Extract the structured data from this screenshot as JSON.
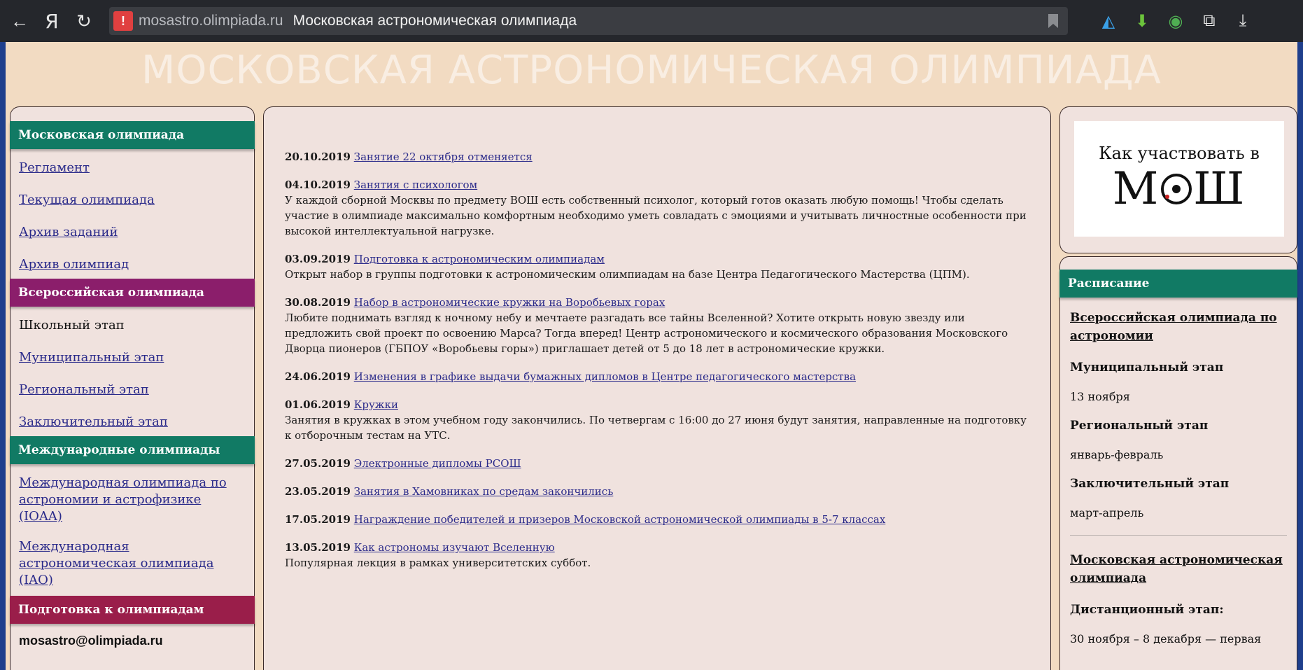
{
  "browser": {
    "back_icon": "←",
    "yandex_icon": "Я",
    "reload_icon": "↻",
    "warning_icon": "!",
    "domain": "mosastro.olimpiada.ru",
    "page_title": "Московская астрономическая олимпиада"
  },
  "site": {
    "title": "МОСКОВСКАЯ АСТРОНОМИЧЕСКАЯ ОЛИМПИАДА"
  },
  "left": {
    "moscow_header": "Московская олимпиада",
    "moscow_links": [
      "Регламент",
      "Текущая олимпиада",
      "Архив заданий",
      "Архив олимпиад"
    ],
    "vsero_header": "Всероссийская олимпиада",
    "vsero_static": "Школьный этап",
    "vsero_links": [
      "Муниципальный этап",
      "Региональный этап",
      "Заключительный этап"
    ],
    "intl_header": "Международные олимпиады",
    "intl_links": [
      "Международная олимпиада по астрономии и астрофизике (IOAA)",
      "Международная астрономическая олимпиада (IAO)"
    ],
    "prep_header": "Подготовка к олимпиадам",
    "email": "mosastro@olimpiada.ru"
  },
  "news": [
    {
      "date": "20.10.2019",
      "title": "Занятие 22 октября отменяется ",
      "text": ""
    },
    {
      "date": "04.10.2019",
      "title": "Занятия с психологом",
      "text": "У каждой сборной Москвы по предмету ВОШ есть собственный психолог, который готов оказать любую помощь! Чтобы сделать участие в олимпиаде максимально комфортным необходимо уметь совладать с эмоциями и учитывать личностные особенности при высокой интеллектуальной нагрузке."
    },
    {
      "date": "03.09.2019",
      "title": "Подготовка к астрономическим олимпиадам",
      "text": "Открыт набор в группы подготовки к астрономическим олимпиадам на базе Центра Педагогического Мастерства (ЦПМ)."
    },
    {
      "date": "30.08.2019",
      "title": "Набор в астрономические кружки на Воробьевых горах",
      "text": "Любите поднимать взгляд к ночному небу и мечтаете разгадать все тайны Вселенной? Хотите открыть новую звезду или предложить свой проект по освоению Марса? Тогда вперед! Центр астрономического и космического образования Московского Дворца пионеров (ГБПОУ «Воробьевы горы») приглашает детей от 5 до 18 лет в астрономические кружки."
    },
    {
      "date": "24.06.2019",
      "title": "Изменения в графике выдачи бумажных дипломов в Центре педагогического мастерства",
      "text": ""
    },
    {
      "date": "01.06.2019",
      "title": "Кружки",
      "text": "Занятия в кружках в этом учебном году закончились. По четвергам с 16:00 до 27 июня будут занятия, направленные на подготовку к отборочным тестам на УТС."
    },
    {
      "date": "27.05.2019",
      "title": "Электронные дипломы РСОШ",
      "text": ""
    },
    {
      "date": "23.05.2019",
      "title": "Занятия в Хамовниках по средам закончились",
      "text": ""
    },
    {
      "date": "17.05.2019",
      "title": "Награждение победителей и призеров Московской астрономической олимпиады в 5-7 классах",
      "text": ""
    },
    {
      "date": "13.05.2019",
      "title": "Как астрономы изучают Вселенную",
      "text": "Популярная лекция в рамках университетских суббот."
    }
  ],
  "howto": {
    "line1": "Как участвовать в",
    "line2_a": "М",
    "line2_b": "Ш"
  },
  "schedule": {
    "header": "Расписание",
    "vsero_link": "Всероссийская олимпиада по астрономии",
    "mun_label": "Муниципальный этап",
    "mun_date": "13 ноября",
    "reg_label": "Региональный этап",
    "reg_date": "январь-февраль",
    "fin_label": "Заключительный этап",
    "fin_date": "март-апрель",
    "mos_link": "Московская астрономическая олимпиада",
    "dist_label": "Дистанционный этап:",
    "dist_date": "30 ноября – 8 декабря — первая"
  }
}
